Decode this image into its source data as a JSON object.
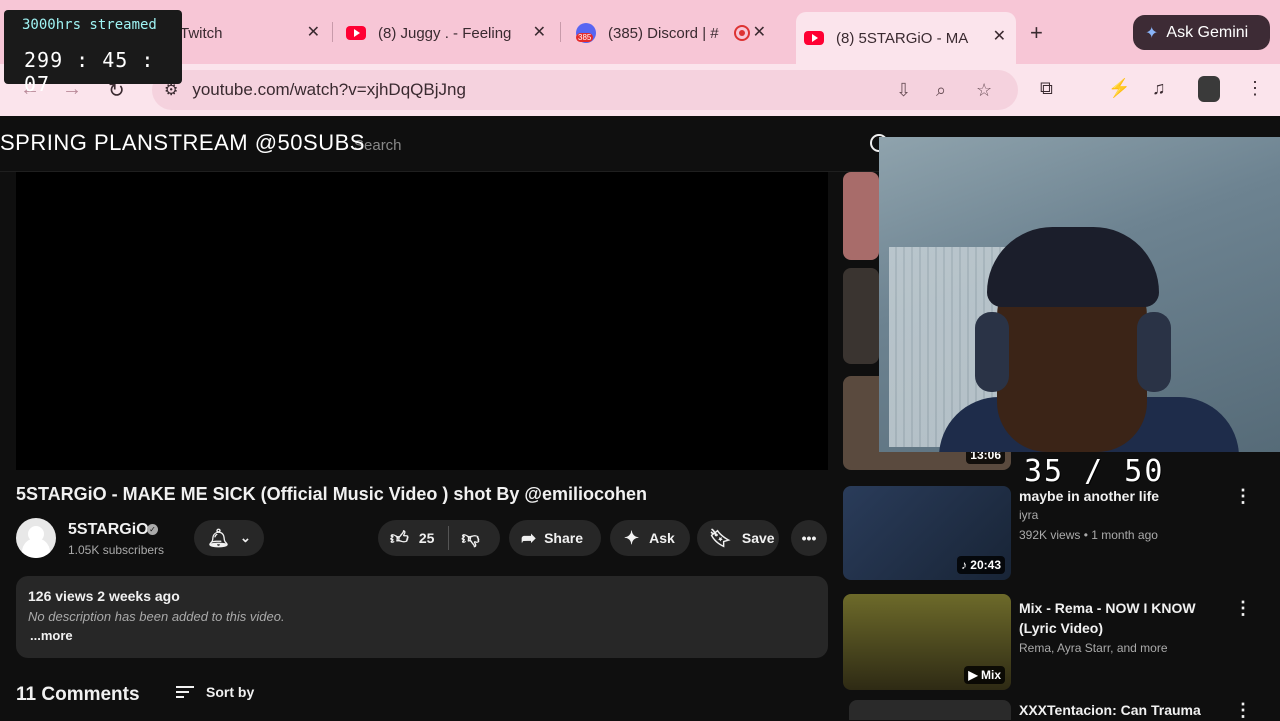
{
  "browser": {
    "tabs": [
      {
        "title": "Twitch"
      },
      {
        "title": "(8) Juggy . - Feeling"
      },
      {
        "title": "(385) Discord | #",
        "badge": "385"
      },
      {
        "title": "(8) 5STARGiO - MA"
      }
    ],
    "new_tab": "+",
    "ask_gemini": "Ask Gemini",
    "url": "youtube.com/watch?v=xjhDqQBjJng"
  },
  "overlay": {
    "streamed_label": "3000hrs streamed",
    "clock": "299 : 45 : 07",
    "banner": "SPRING PLANSTREAM @50SUBS",
    "counter": "35 / 50"
  },
  "youtube": {
    "search_placeholder": "Search",
    "video": {
      "title": "5STARGiO - MAKE ME SICK (Official Music Video ) shot By @emiliocohen",
      "channel": "5STARGiO",
      "subscribers": "1.05K subscribers",
      "likes": "25",
      "share": "Share",
      "ask": "Ask",
      "save": "Save",
      "views_date": "126 views  2 weeks ago",
      "description": "No description has been added to this video.",
      "more": "...more",
      "comments": "11 Comments",
      "sort_by": "Sort by"
    },
    "related": [
      {
        "duration": "13:06"
      },
      {
        "title": "maybe in another life",
        "channel": "iyra",
        "meta": "392K views • 1 month ago",
        "duration": "20:43"
      },
      {
        "title": "Mix - Rema - NOW I KNOW (Lyric Video)",
        "channel": "Rema, Ayra Starr, and more",
        "duration": "Mix"
      },
      {
        "title": "XXXTentacion: Can Trauma"
      }
    ]
  }
}
